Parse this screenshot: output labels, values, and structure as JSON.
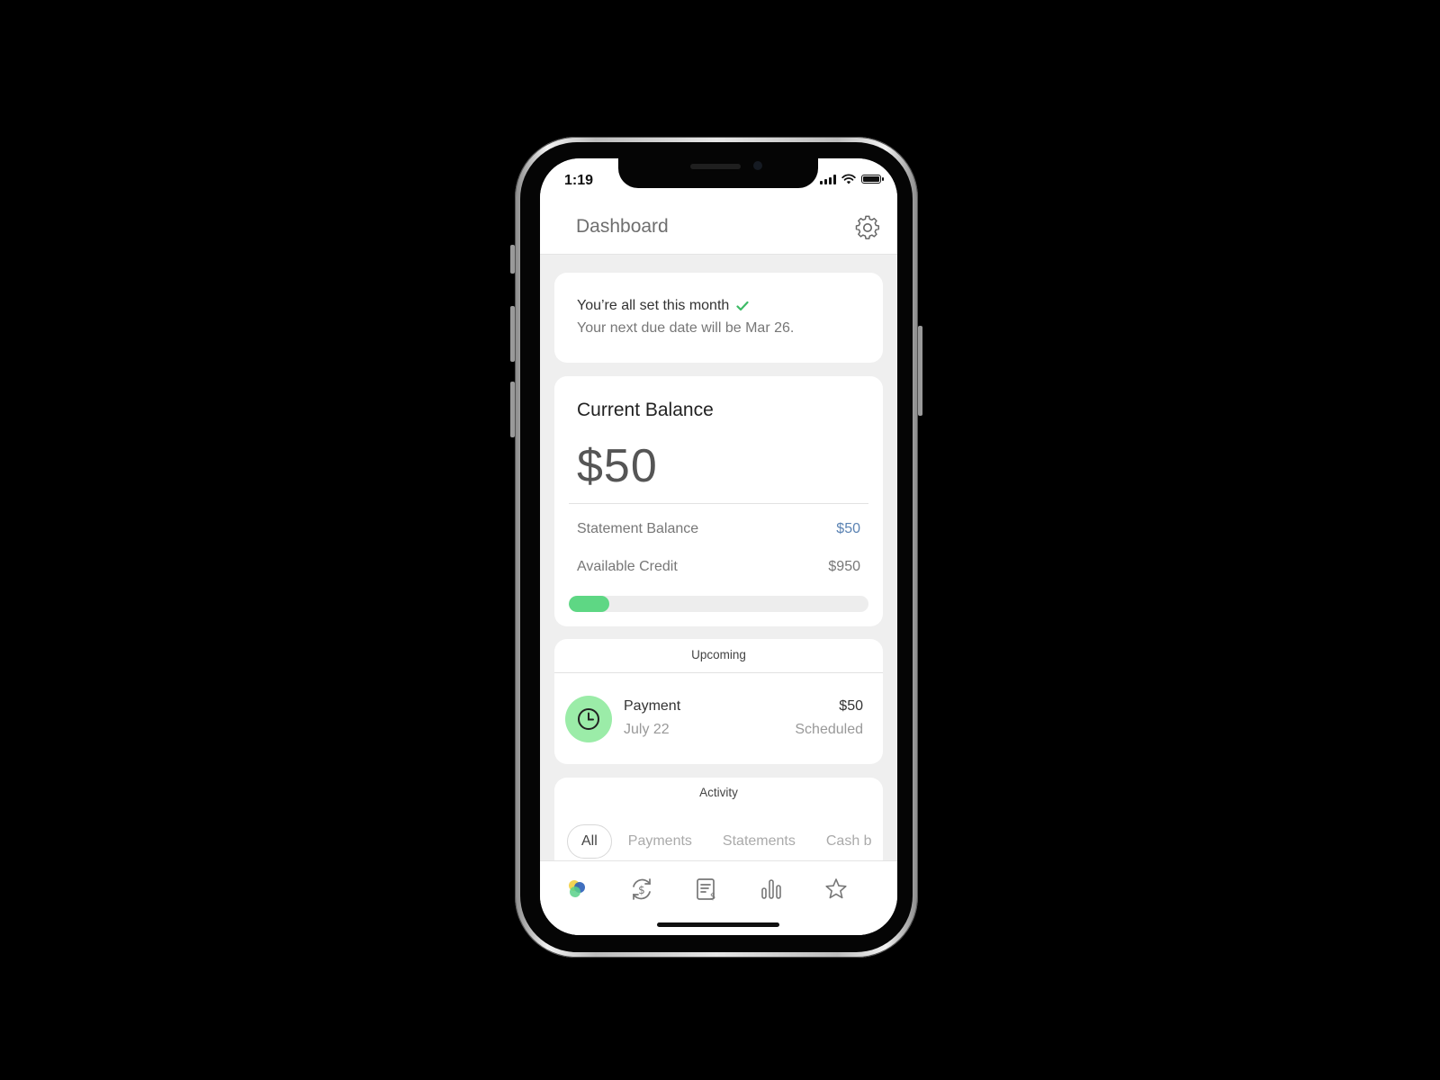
{
  "status_bar": {
    "time": "1:19"
  },
  "header": {
    "title": "Dashboard"
  },
  "status_card": {
    "title": "You’re all set this month",
    "subtitle": "Your next due date will be Mar 26."
  },
  "balance": {
    "title": "Current Balance",
    "amount": "$50",
    "statement_label": "Statement Balance",
    "statement_value": "$50",
    "available_label": "Available Credit",
    "available_value": "$950",
    "usage_fraction": 0.05
  },
  "upcoming": {
    "label": "Upcoming",
    "payment": {
      "title": "Payment",
      "date": "July 22",
      "amount": "$50",
      "status": "Scheduled"
    }
  },
  "activity": {
    "label": "Activity",
    "tabs": [
      "All",
      "Payments",
      "Statements",
      "Cash b"
    ]
  },
  "tabbar": {
    "items": [
      "home-logo-icon",
      "payment-cycle-icon",
      "statements-icon",
      "insights-chart-icon",
      "rewards-star-icon"
    ]
  },
  "colors": {
    "accent_green": "#5ed784",
    "icon_green": "#9beca8",
    "link_blue": "#5b83b3",
    "check_green": "#3dbb66"
  }
}
